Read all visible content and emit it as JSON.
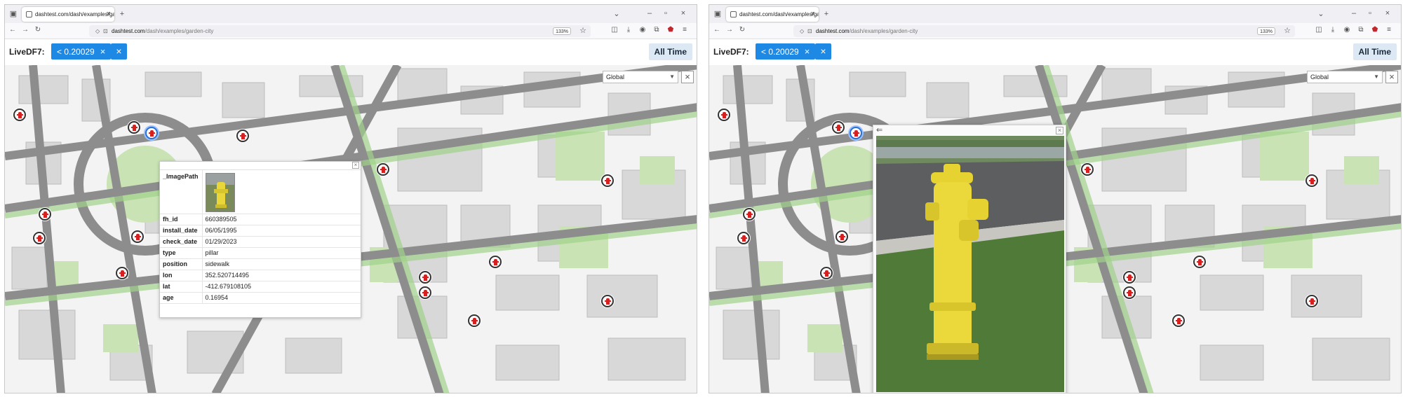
{
  "browser": {
    "tab_title": "dashtest.com/dash/examples/ga",
    "url_host": "dashtest.com",
    "url_path": "/dash/examples/garden-city",
    "zoom": "133%"
  },
  "appbar": {
    "label": "LiveDF7:",
    "filter_chip": "< 0.20029",
    "time_button": "All Time"
  },
  "map": {
    "scope_select": "Global"
  },
  "popup": {
    "image_label": "_ImagePath",
    "rows": [
      {
        "key": "fh_id",
        "value": "660389505"
      },
      {
        "key": "install_date",
        "value": "06/05/1995"
      },
      {
        "key": "check_date",
        "value": "01/29/2023"
      },
      {
        "key": "type",
        "value": "pillar"
      },
      {
        "key": "position",
        "value": "sidewalk"
      },
      {
        "key": "lon",
        "value": "352.520714495"
      },
      {
        "key": "lat",
        "value": "-412.679108105"
      },
      {
        "key": "age",
        "value": "0.16954"
      }
    ]
  },
  "colors": {
    "accent": "#1e88e5",
    "marker": "#d62020",
    "hydrant": "#e8d63a"
  }
}
